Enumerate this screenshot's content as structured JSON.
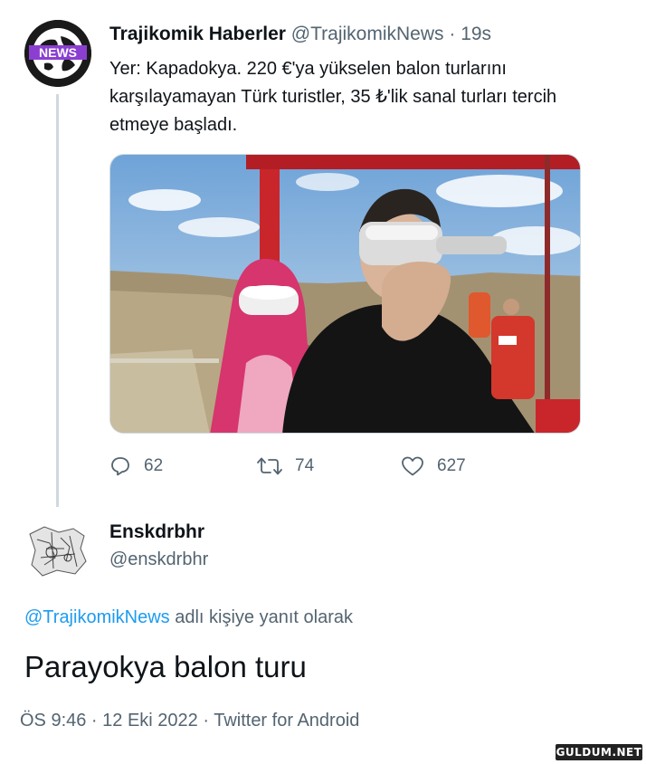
{
  "tweet": {
    "display_name": "Trajikomik Haberler",
    "handle": "@TrajikomikNews",
    "separator": "·",
    "time": "19s",
    "avatar_badge": "NEWS",
    "text": "Yer: Kapadokya. 220 €'ya yükselen balon turlarını karşılayamayan Türk turistler, 35 ₺'lik sanal turları tercih etmeye başladı.",
    "stats": {
      "replies": "62",
      "retweets": "74",
      "likes": "627"
    }
  },
  "reply": {
    "display_name": "Enskdrbhr",
    "handle": "@enskdrbhr",
    "replying_mention": "@TrajikomikNews",
    "replying_suffix": " adlı kişiye yanıt olarak",
    "text": "Parayokya balon turu",
    "meta": "ÖS 9:46 · 12 Eki 2022 · Twitter for Android"
  },
  "watermark": "GULDUM.NET",
  "colors": {
    "accent": "#1d9bf0",
    "muted": "#536471",
    "text": "#0f1419",
    "line": "#cfd9de"
  }
}
